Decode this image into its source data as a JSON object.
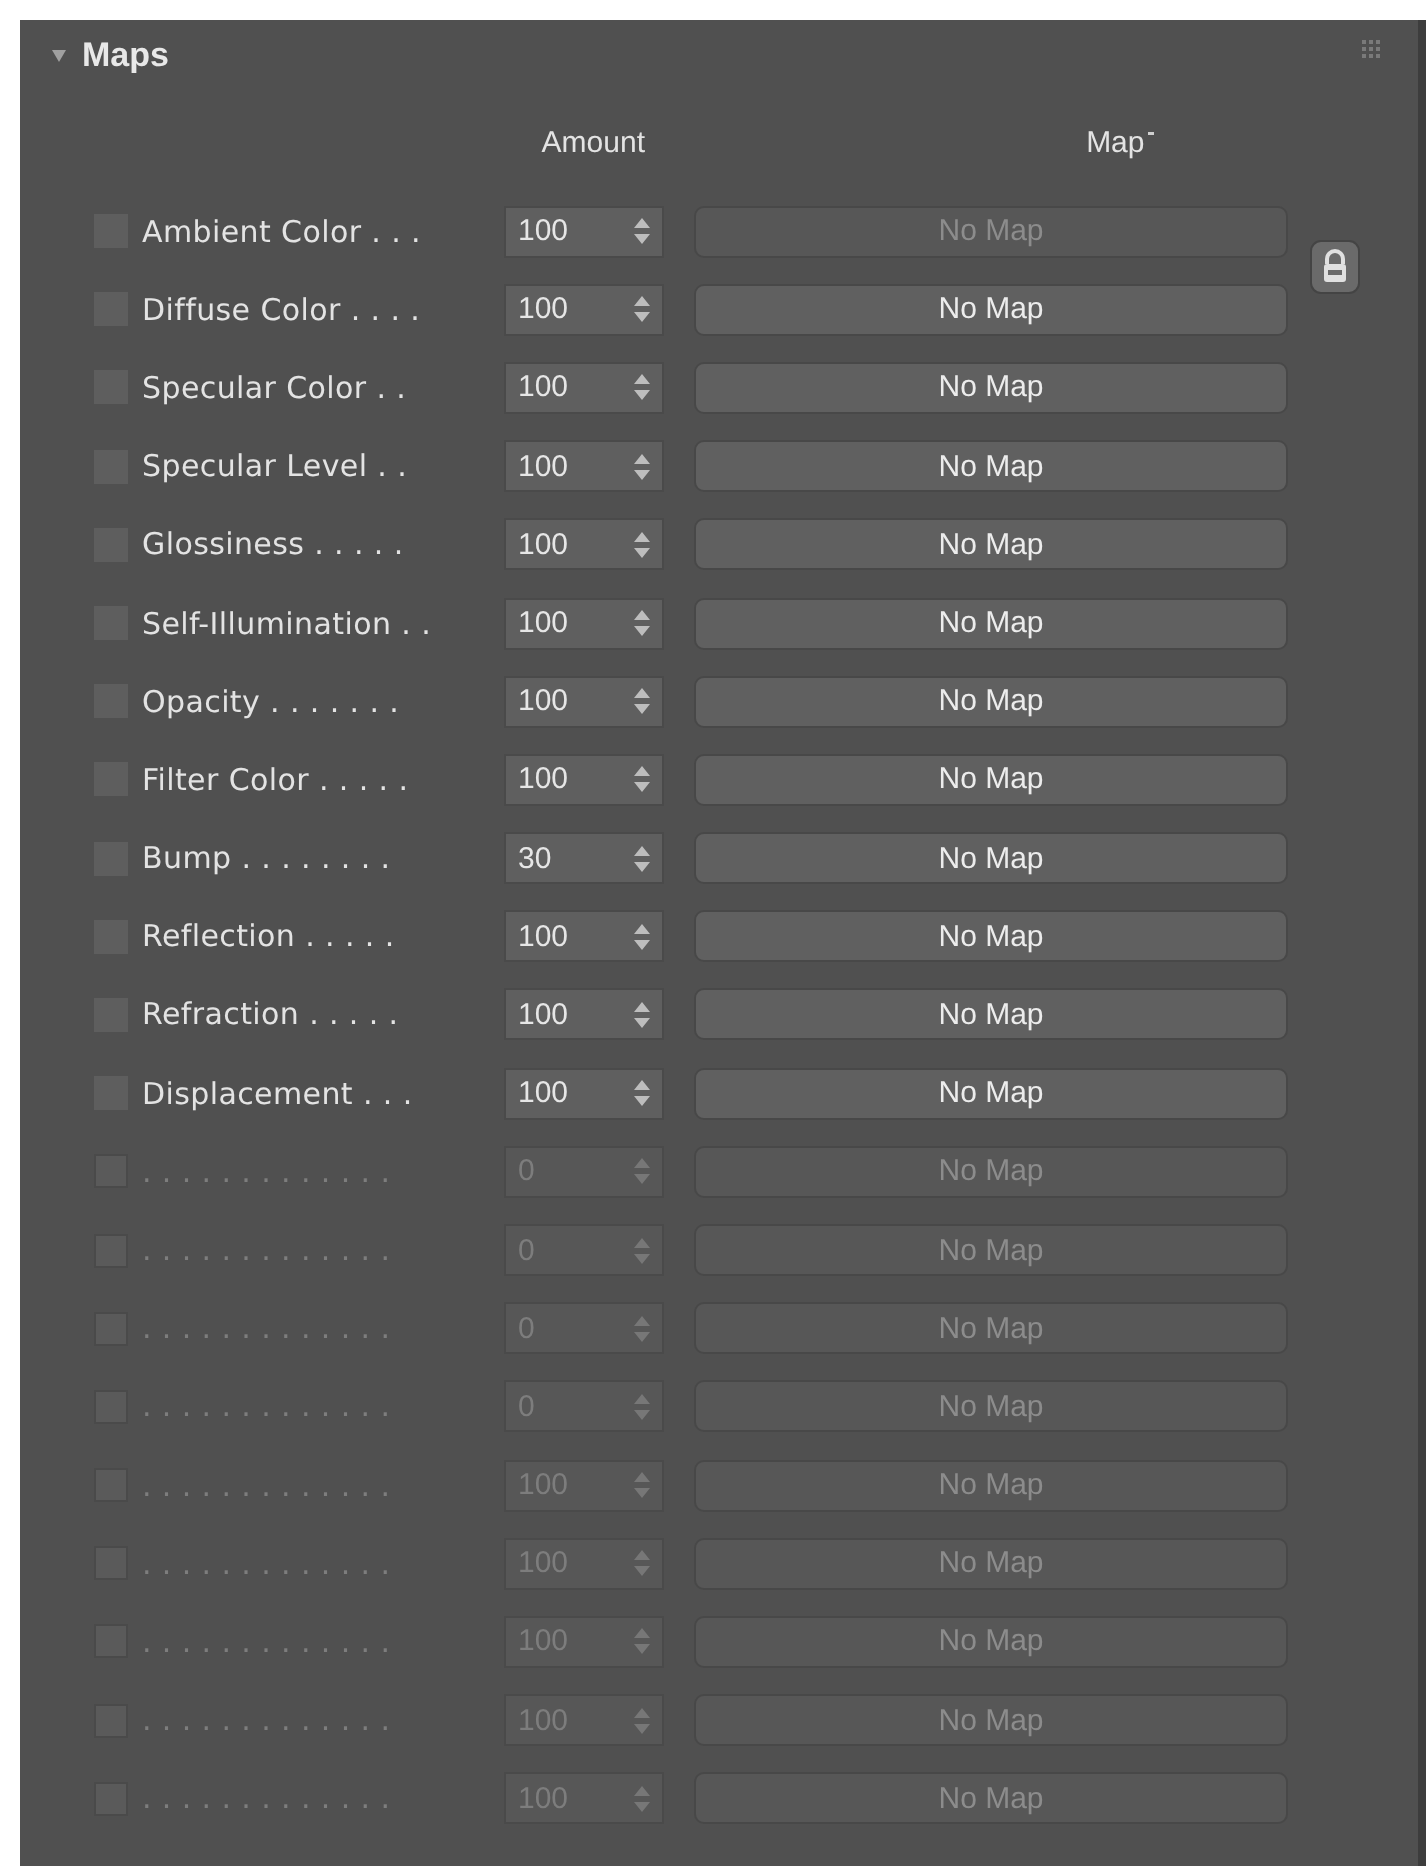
{
  "rollout": {
    "title": "Maps",
    "expanded": true
  },
  "columns": {
    "amount": "Amount",
    "map": "Map"
  },
  "rows": [
    {
      "label": "Ambient Color . . .",
      "amount": "100",
      "map": "No Map",
      "checked": false,
      "disabled": false,
      "map_disabled": true
    },
    {
      "label": "Diffuse Color . . . .",
      "amount": "100",
      "map": "No Map",
      "checked": false,
      "disabled": false,
      "map_disabled": false
    },
    {
      "label": "Specular Color . .",
      "amount": "100",
      "map": "No Map",
      "checked": false,
      "disabled": false,
      "map_disabled": false
    },
    {
      "label": "Specular Level . .",
      "amount": "100",
      "map": "No Map",
      "checked": false,
      "disabled": false,
      "map_disabled": false
    },
    {
      "label": "Glossiness . . . . .",
      "amount": "100",
      "map": "No Map",
      "checked": false,
      "disabled": false,
      "map_disabled": false
    },
    {
      "label": "Self-Illumination . .",
      "amount": "100",
      "map": "No Map",
      "checked": false,
      "disabled": false,
      "map_disabled": false
    },
    {
      "label": "Opacity . . . . . . .",
      "amount": "100",
      "map": "No Map",
      "checked": false,
      "disabled": false,
      "map_disabled": false
    },
    {
      "label": "Filter Color . . . . .",
      "amount": "100",
      "map": "No Map",
      "checked": false,
      "disabled": false,
      "map_disabled": false
    },
    {
      "label": "Bump . . . . . . . .",
      "amount": "30",
      "map": "No Map",
      "checked": false,
      "disabled": false,
      "map_disabled": false
    },
    {
      "label": "Reflection . . . . .",
      "amount": "100",
      "map": "No Map",
      "checked": false,
      "disabled": false,
      "map_disabled": false
    },
    {
      "label": "Refraction . . . . .",
      "amount": "100",
      "map": "No Map",
      "checked": false,
      "disabled": false,
      "map_disabled": false
    },
    {
      "label": "Displacement . . .",
      "amount": "100",
      "map": "No Map",
      "checked": false,
      "disabled": false,
      "map_disabled": false
    },
    {
      "label": ". . . . . . . . . . . . .",
      "amount": "0",
      "map": "No Map",
      "checked": false,
      "disabled": true,
      "map_disabled": true
    },
    {
      "label": ". . . . . . . . . . . . .",
      "amount": "0",
      "map": "No Map",
      "checked": false,
      "disabled": true,
      "map_disabled": true
    },
    {
      "label": ". . . . . . . . . . . . .",
      "amount": "0",
      "map": "No Map",
      "checked": false,
      "disabled": true,
      "map_disabled": true
    },
    {
      "label": ". . . . . . . . . . . . .",
      "amount": "0",
      "map": "No Map",
      "checked": false,
      "disabled": true,
      "map_disabled": true
    },
    {
      "label": ". . . . . . . . . . . . .",
      "amount": "100",
      "map": "No Map",
      "checked": false,
      "disabled": true,
      "map_disabled": true
    },
    {
      "label": ". . . . . . . . . . . . .",
      "amount": "100",
      "map": "No Map",
      "checked": false,
      "disabled": true,
      "map_disabled": true
    },
    {
      "label": ". . . . . . . . . . . . .",
      "amount": "100",
      "map": "No Map",
      "checked": false,
      "disabled": true,
      "map_disabled": true
    },
    {
      "label": ". . . . . . . . . . . . .",
      "amount": "100",
      "map": "No Map",
      "checked": false,
      "disabled": true,
      "map_disabled": true
    },
    {
      "label": ". . . . . . . . . . . . .",
      "amount": "100",
      "map": "No Map",
      "checked": false,
      "disabled": true,
      "map_disabled": true
    }
  ]
}
